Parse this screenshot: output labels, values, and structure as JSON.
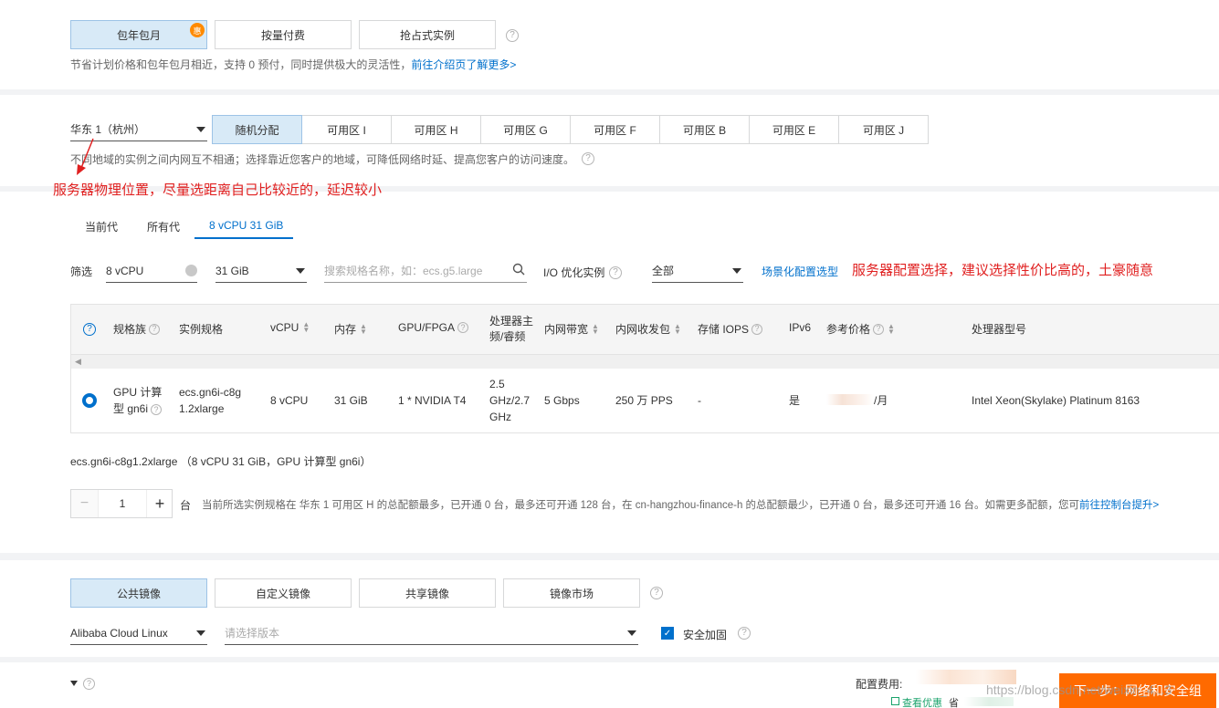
{
  "billing": {
    "options": [
      "包年包月",
      "按量付费",
      "抢占式实例"
    ],
    "badge": "惠",
    "note": "节省计划价格和包年包月相近，支持 0 预付，同时提供极大的灵活性，",
    "note_link": "前往介绍页了解更多>"
  },
  "region": {
    "selected": "华东 1（杭州）",
    "zones": [
      "随机分配",
      "可用区 I",
      "可用区 H",
      "可用区 G",
      "可用区 F",
      "可用区 B",
      "可用区 E",
      "可用区 J"
    ],
    "note": "不同地域的实例之间内网互不相通；选择靠近您客户的地域，可降低网络时延、提高您客户的访问速度。",
    "annotation": "服务器物理位置，尽量选距离自己比较近的，延迟较小"
  },
  "instance": {
    "tabs": [
      "当前代",
      "所有代",
      "8 vCPU 31 GiB"
    ],
    "filter_label": "筛选",
    "cpu_filter": "8 vCPU",
    "mem_filter": "31 GiB",
    "search_placeholder": "搜索规格名称，如：ecs.g5.large",
    "io_label": "I/O 优化实例",
    "io_value": "全部",
    "scenario_link": "场景化配置选型",
    "annotation": "服务器配置选择，建议选择性价比高的，土豪随意",
    "headers": {
      "family": "规格族",
      "spec": "实例规格",
      "vcpu": "vCPU",
      "mem": "内存",
      "gpu": "GPU/FPGA",
      "freq": "处理器主频/睿频",
      "bandwidth": "内网带宽",
      "pps": "内网收发包",
      "iops": "存储 IOPS",
      "ipv6": "IPv6",
      "price": "参考价格",
      "model": "处理器型号"
    },
    "row": {
      "family": "GPU 计算型 gn6i",
      "spec": "ecs.gn6i-c8g1.2xlarge",
      "vcpu": "8 vCPU",
      "mem": "31 GiB",
      "gpu": "1 * NVIDIA T4",
      "freq": "2.5 GHz/2.7 GHz",
      "bandwidth": "5 Gbps",
      "pps": "250 万 PPS",
      "iops": "-",
      "ipv6": "是",
      "price": "/月",
      "model": "Intel Xeon(Skylake) Platinum 8163"
    },
    "selected_summary": "ecs.gn6i-c8g1.2xlarge （8 vCPU 31 GiB，GPU 计算型 gn6i）",
    "quantity": "1",
    "unit": "台",
    "quota_note": "当前所选实例规格在 华东 1 可用区 H 的总配额最多，已开通 0 台，最多还可开通 128 台，在 cn-hangzhou-finance-h 的总配额最少，已开通 0 台，最多还可开通 16 台。如需更多配额，您可",
    "quota_link": "前往控制台提升>"
  },
  "image": {
    "tabs": [
      "公共镜像",
      "自定义镜像",
      "共享镜像",
      "镜像市场"
    ],
    "os": "Alibaba Cloud Linux",
    "version_placeholder": "请选择版本",
    "security_label": "安全加固"
  },
  "footer": {
    "config_fee_label": "配置费用:",
    "discount_link": "查看优惠",
    "save_label": "省",
    "next_button": "下一步：网络和安全组",
    "watermark": "https://blog.csdn.net/weixin_4...3"
  },
  "colors": {
    "accent": "#0070cc",
    "active_bg": "#d8eaf7",
    "annotation": "#e02020",
    "primary_button": "#ff6a00"
  }
}
